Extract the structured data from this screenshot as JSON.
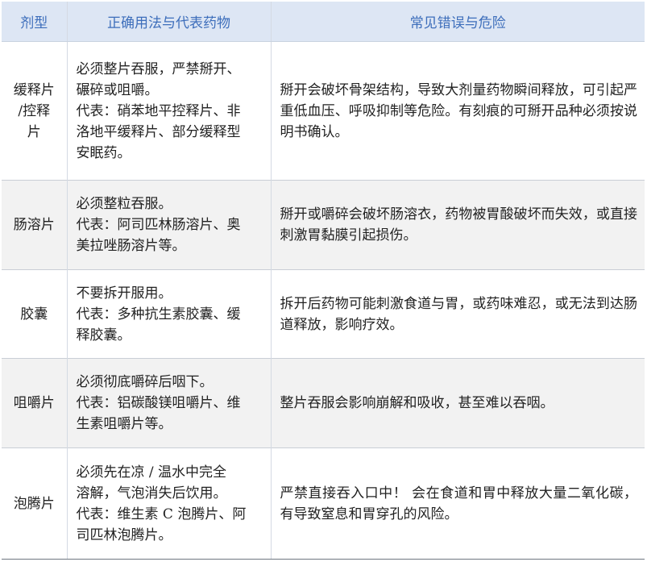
{
  "headers": {
    "type": "剂型",
    "usage": "正确用法与代表药物",
    "risk": "常见错误与危险"
  },
  "rows": [
    {
      "type_lines": [
        "缓释片",
        "/控释",
        "片"
      ],
      "usage_lines": [
        "必须整片吞服，严禁掰开、",
        "碾碎或咀嚼。",
        "代表：硝苯地平控释片、非",
        "洛地平缓释片、部分缓释型",
        "安眠药。"
      ],
      "risk": "掰开会破坏骨架结构，导致大剂量药物瞬间释放，可引起严重低血压、呼吸抑制等危险。有刻痕的可掰开品种必须按说明书确认。"
    },
    {
      "type_lines": [
        "肠溶片"
      ],
      "usage_lines": [
        "必须整粒吞服。",
        "代表：阿司匹林肠溶片、奥",
        "美拉唑肠溶片等。"
      ],
      "risk": "掰开或嚼碎会破坏肠溶衣，药物被胃酸破坏而失效，或直接刺激胃黏膜引起损伤。"
    },
    {
      "type_lines": [
        "胶囊"
      ],
      "usage_lines": [
        "不要拆开服用。",
        "代表：多种抗生素胶囊、缓",
        "释胶囊。"
      ],
      "risk": "拆开后药物可能刺激食道与胃，或药味难忍，或无法到达肠道释放，影响疗效。"
    },
    {
      "type_lines": [
        "咀嚼片"
      ],
      "usage_lines": [
        "必须彻底嚼碎后咽下。",
        "代表：铝碳酸镁咀嚼片、维",
        "生素咀嚼片等。"
      ],
      "risk": "整片吞服会影响崩解和吸收，甚至难以吞咽。"
    },
    {
      "type_lines": [
        "泡腾片"
      ],
      "usage_lines": [
        "必须先在凉 / 温水中完全",
        "溶解，气泡消失后饮用。",
        "代表：维生素 C 泡腾片、阿",
        "司匹林泡腾片。"
      ],
      "risk": "严禁直接吞入口中！ 会在食道和胃中释放大量二氧化碳，有导致窒息和胃穿孔的风险。"
    }
  ]
}
